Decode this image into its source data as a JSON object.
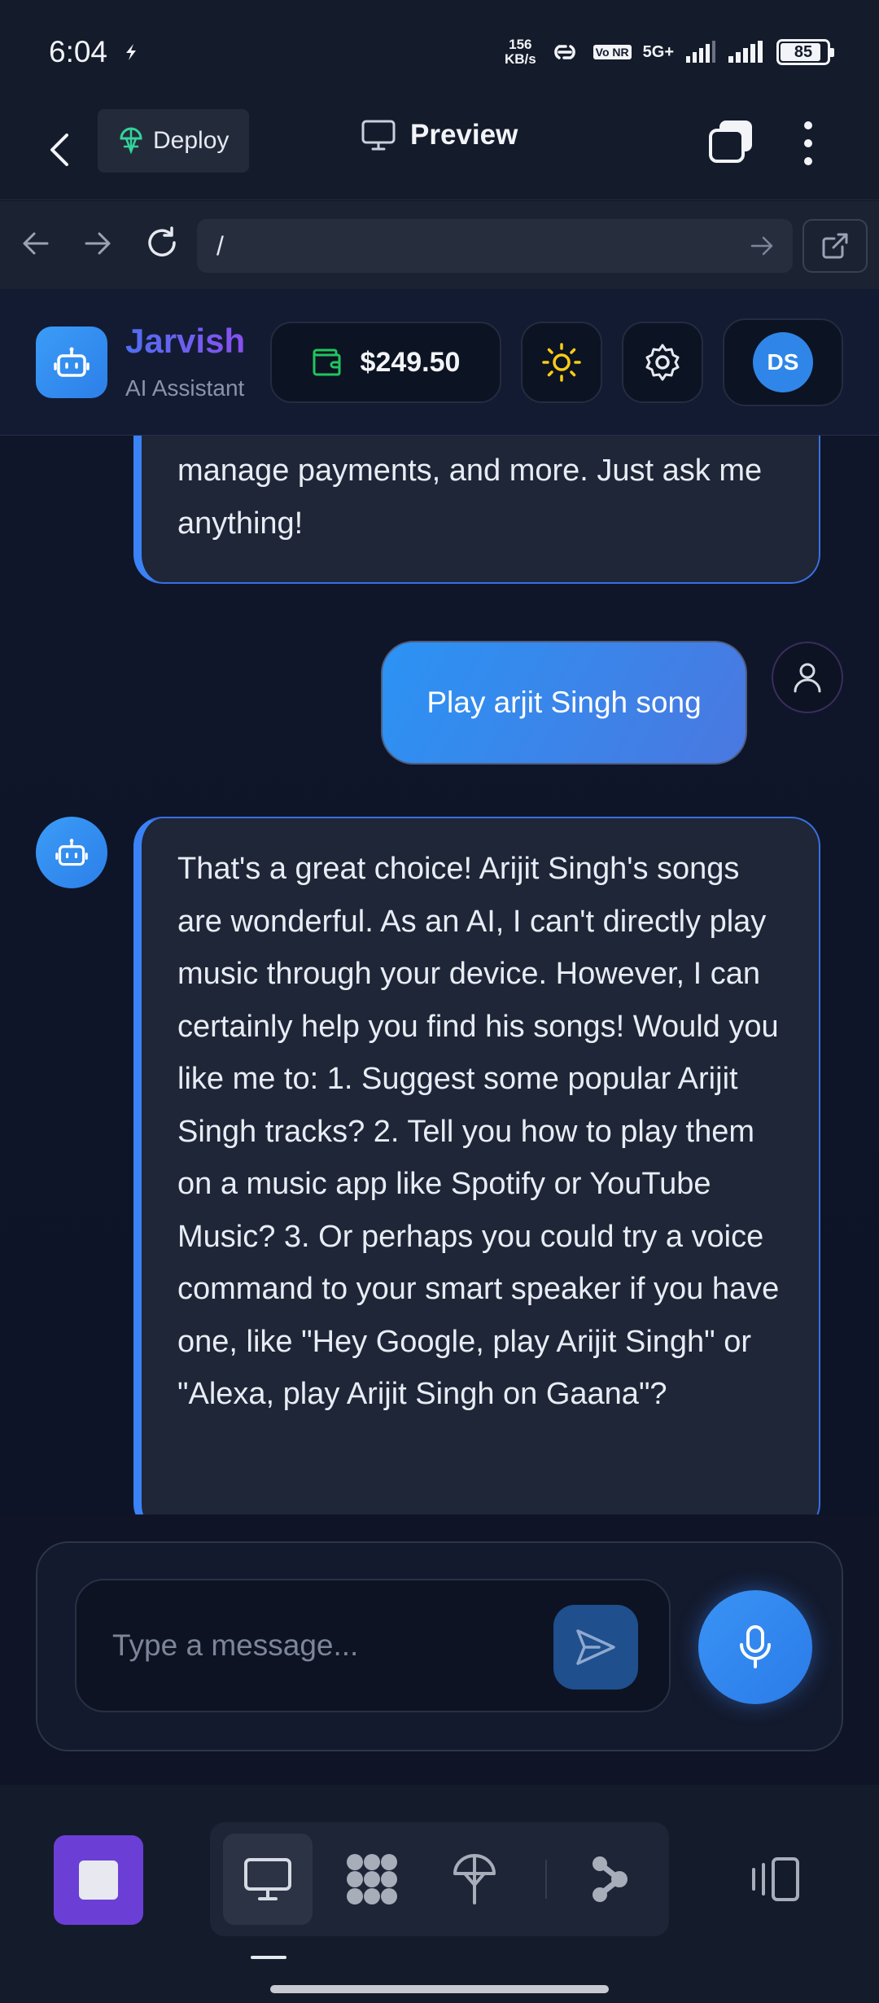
{
  "status_bar": {
    "time": "6:04",
    "net_speed_value": "156",
    "net_speed_unit": "KB/s",
    "volte": "Vo NR",
    "network": "5G+",
    "battery": "85"
  },
  "app_bar": {
    "deploy_label": "Deploy",
    "preview_label": "Preview"
  },
  "browser": {
    "url": "/"
  },
  "header": {
    "brand": "Jarvish",
    "subtitle": "AI Assistant",
    "balance": "$249.50",
    "avatar_initials": "DS"
  },
  "messages": [
    {
      "role": "assistant",
      "text": "manage payments, and more. Just ask me anything!"
    },
    {
      "role": "user",
      "text": "Play arjit Singh song"
    },
    {
      "role": "assistant",
      "text": "That's a great choice! Arijit Singh's songs are wonderful. As an AI, I can't directly play music through your device. However, I can certainly help you find his songs! Would you like me to: 1. Suggest some popular Arijit Singh tracks? 2. Tell you how to play them on a music app like Spotify or YouTube Music? 3. Or perhaps you could try a voice command to your smart speaker if you have one, like \"Hey Google, play Arijit Singh\" or \"Alexa, play Arijit Singh on Gaana\"?"
    }
  ],
  "composer": {
    "placeholder": "Type a message..."
  },
  "colors": {
    "accent_blue": "#3b82f6",
    "brand_purple": "#8a4ff0",
    "stop_purple": "#6b3fd6",
    "wallet_green": "#22c55e",
    "sun_yellow": "#facc15"
  }
}
